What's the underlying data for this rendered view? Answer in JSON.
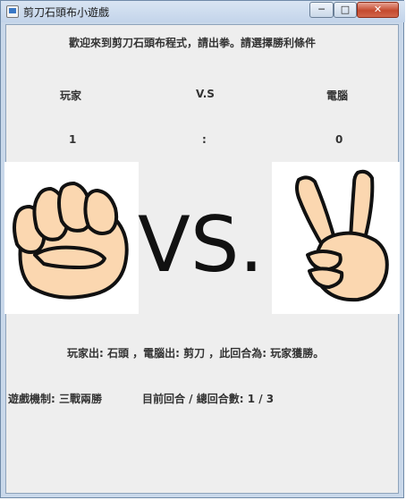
{
  "window": {
    "title": "剪刀石頭布小遊戲",
    "minimize": "─",
    "maximize": "□",
    "close": "✕"
  },
  "game": {
    "welcome": "歡迎來到剪刀石頭布程式，請出拳。請選擇勝利條件",
    "player_label": "玩家",
    "vs_label": "V.S",
    "computer_label": "電腦",
    "player_score": "1",
    "score_separator": ":",
    "computer_score": "0",
    "result_text": "玩家出: 石頭 ，電腦出: 剪刀 ，此回合為: 玩家獲勝。",
    "mode_text": "遊戲機制: 三戰兩勝",
    "round_text": "目前回合 / 總回合數: 1 / 3",
    "vs_image_text": "VS.",
    "player_hand": "rock-hand",
    "computer_hand": "scissors-hand"
  },
  "colors": {
    "client_bg": "#eeeeee",
    "skin": "#fbd7b0",
    "outline": "#111111"
  }
}
